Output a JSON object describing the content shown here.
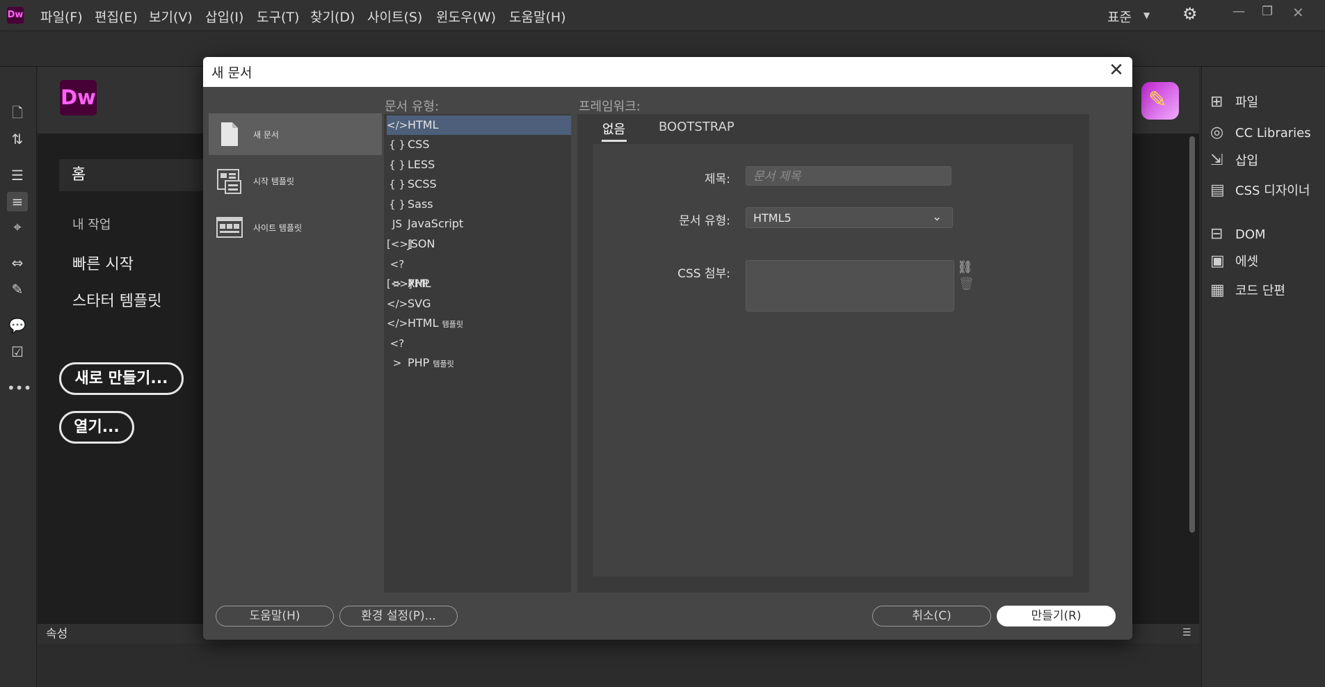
{
  "app": {
    "logo": "Dw"
  },
  "menubar": {
    "items": [
      "파일(F)",
      "편집(E)",
      "보기(V)",
      "삽입(I)",
      "도구(T)",
      "찾기(D)",
      "사이트(S)",
      "윈도우(W)",
      "도움말(H)"
    ],
    "workspace": "표준"
  },
  "home": {
    "logo": "Dw",
    "tab": "홈",
    "my_work": "내 작업",
    "quick_start": "빠른 시작",
    "starter_templates": "스타터 템플릿",
    "new_button": "새로 만들기...",
    "open_button": "열기..."
  },
  "properties": {
    "label": "속성"
  },
  "right_panel": {
    "items": [
      "파일",
      "CC Libraries",
      "삽입",
      "CSS 디자이너",
      "DOM",
      "에셋",
      "코드 단편"
    ]
  },
  "dialog": {
    "title": "새 문서",
    "categories": [
      "새 문서",
      "시작 템플릿",
      "사이트 템플릿"
    ],
    "selected_category": "새 문서",
    "doc_type_label": "문서 유형:",
    "framework_label": "프레임워크:",
    "doc_types": [
      {
        "icon": "</>",
        "label": "HTML",
        "suffix": ""
      },
      {
        "icon": "{ }",
        "label": "CSS",
        "suffix": ""
      },
      {
        "icon": "{ }",
        "label": "LESS",
        "suffix": ""
      },
      {
        "icon": "{ }",
        "label": "SCSS",
        "suffix": ""
      },
      {
        "icon": "{ }",
        "label": "Sass",
        "suffix": ""
      },
      {
        "icon": "JS",
        "label": "JavaScript",
        "suffix": ""
      },
      {
        "icon": "[<>]",
        "label": "JSON",
        "suffix": ""
      },
      {
        "icon": "<?>",
        "label": "PHP",
        "suffix": ""
      },
      {
        "icon": "[<>]",
        "label": "XML",
        "suffix": ""
      },
      {
        "icon": "</>",
        "label": "SVG",
        "suffix": ""
      },
      {
        "icon": "</>",
        "label": "HTML",
        "suffix": "템플릿"
      },
      {
        "icon": "<?>",
        "label": "PHP",
        "suffix": "템플릿"
      }
    ],
    "selected_doc_type": "HTML",
    "framework_tabs": [
      "없음",
      "BOOTSTRAP"
    ],
    "active_framework_tab": "없음",
    "form": {
      "title_label": "제목:",
      "title_placeholder": "문서 제목",
      "doctype_label": "문서 유형:",
      "doctype_value": "HTML5",
      "css_label": "CSS 첨부:"
    },
    "buttons": {
      "help": "도움말(H)",
      "preferences": "환경 설정(P)...",
      "cancel": "취소(C)",
      "create": "만들기(R)"
    }
  },
  "colors": {
    "accent_selected": "#4d5f7a",
    "dw_brand": "#470137",
    "dw_brand_text": "#ff61f6"
  }
}
